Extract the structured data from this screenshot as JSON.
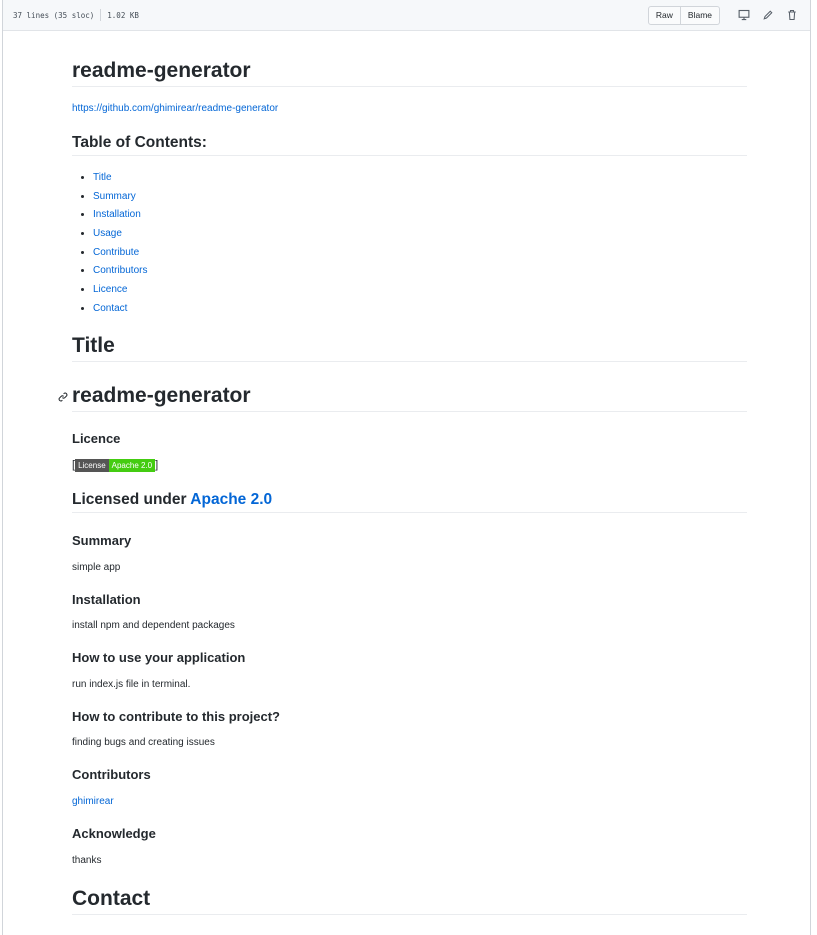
{
  "file_header": {
    "lines": "37 lines (35 sloc)",
    "size": "1.02 KB",
    "raw_label": "Raw",
    "blame_label": "Blame"
  },
  "readme": {
    "title": "readme-generator",
    "repo_link": "https://github.com/ghimirear/readme-generator",
    "toc_heading": "Table of Contents:",
    "toc": [
      "Title",
      "Summary",
      "Installation",
      "Usage",
      "Contribute",
      "Contributors",
      "Licence",
      "Contact"
    ],
    "title_heading": "Title",
    "project_title": "readme-generator",
    "licence_heading": "Licence",
    "badge_left": "License",
    "badge_right": "Apache 2.0",
    "licensed_under": "Licensed under ",
    "license_name": "Apache 2.0",
    "summary_heading": "Summary",
    "summary_text": "simple app",
    "installation_heading": "Installation",
    "installation_text": "install npm and dependent packages",
    "usage_heading": "How to use your application",
    "usage_text": "run index.js file in terminal.",
    "contribute_heading": "How to contribute to this project?",
    "contribute_text": "finding bugs and creating issues",
    "contributors_heading": "Contributors",
    "contributor": "ghimirear",
    "acknowledge_heading": "Acknowledge",
    "acknowledge_text": "thanks",
    "contact_heading": "Contact"
  }
}
